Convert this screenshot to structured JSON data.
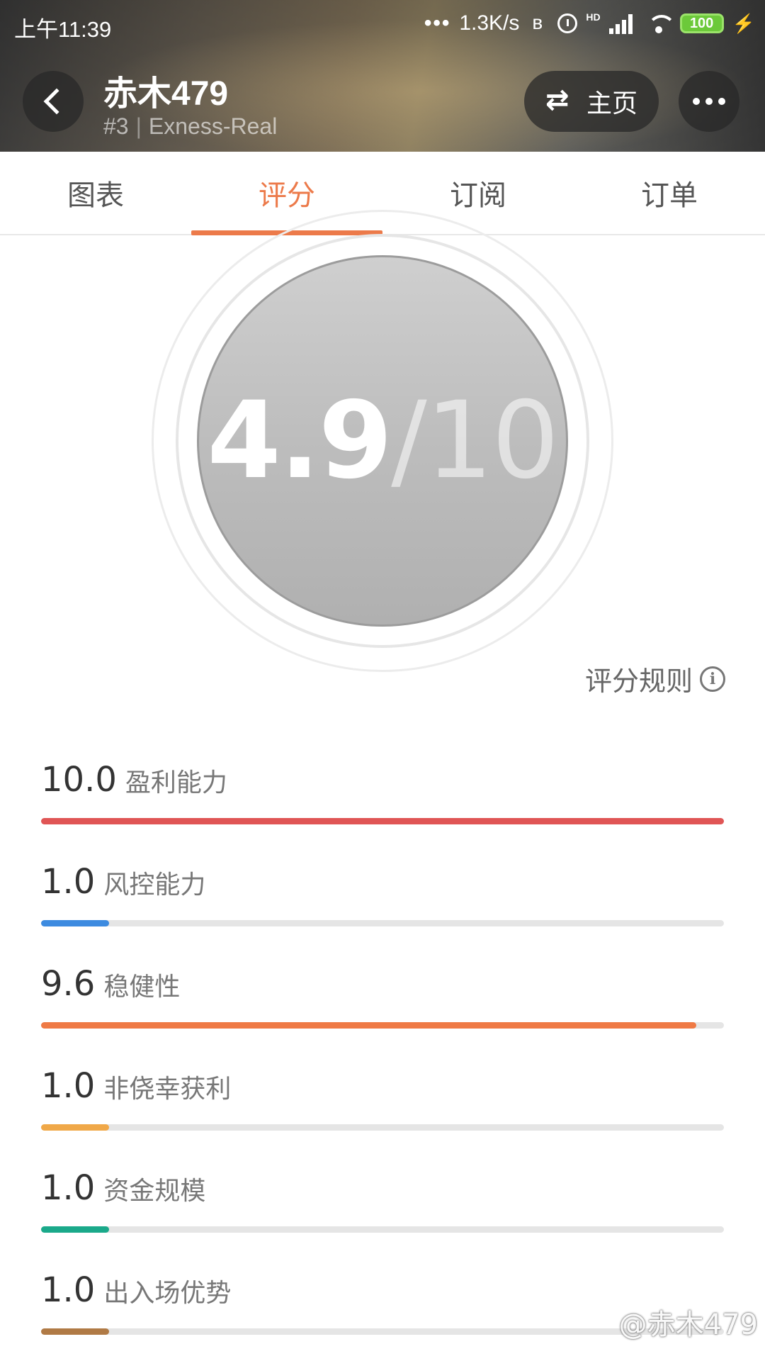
{
  "status": {
    "time": "上午11:39",
    "speed": "1.3K/s",
    "network_badge": "HD",
    "battery": "100"
  },
  "header": {
    "title": "赤木479",
    "rank": "#3",
    "account": "Exness-Real",
    "home_label": "主页"
  },
  "tabs": [
    "图表",
    "评分",
    "订阅",
    "订单"
  ],
  "active_tab": "评分",
  "score": {
    "value": "4.9",
    "max": "10"
  },
  "rules_label": "评分规则",
  "metrics": [
    {
      "value": "10.0",
      "label": "盈利能力",
      "fraction": 1.0,
      "color": "#e05555"
    },
    {
      "value": "1.0",
      "label": "风控能力",
      "fraction": 0.1,
      "color": "#3d8be0"
    },
    {
      "value": "9.6",
      "label": "稳健性",
      "fraction": 0.96,
      "color": "#ef7a45"
    },
    {
      "value": "1.0",
      "label": "非侥幸获利",
      "fraction": 0.1,
      "color": "#f0a848"
    },
    {
      "value": "1.0",
      "label": "资金规模",
      "fraction": 0.1,
      "color": "#1aa98a"
    },
    {
      "value": "1.0",
      "label": "出入场优势",
      "fraction": 0.1,
      "color": "#b07a45"
    }
  ],
  "watermark": "@赤木479"
}
